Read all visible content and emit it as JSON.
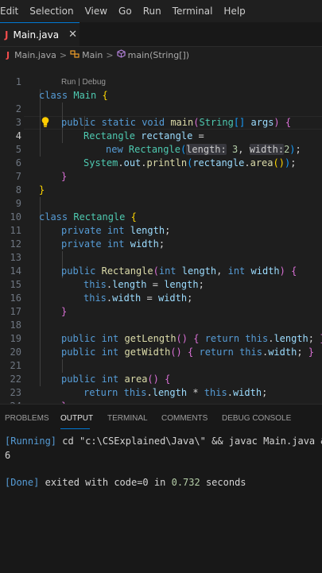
{
  "menu": [
    "Edit",
    "Selection",
    "View",
    "Go",
    "Run",
    "Terminal",
    "Help"
  ],
  "tab": {
    "icon": "J",
    "label": "Main.java",
    "close": "✕"
  },
  "breadcrumb": {
    "file": "Main.java",
    "class_name": "Main",
    "method": "main(String[])",
    "sep": ">"
  },
  "codelens": "Run | Debug",
  "line_numbers": [
    "1",
    "2",
    "3",
    "4",
    "5",
    "6",
    "7",
    "8",
    "9",
    "10",
    "11",
    "12",
    "13",
    "14",
    "15",
    "16",
    "17",
    "18",
    "19",
    "20",
    "21",
    "22",
    "23",
    "24"
  ],
  "code": {
    "l1": {
      "kw": "class",
      "name": "Main",
      "brace": "{"
    },
    "l2": {
      "kw1": "public",
      "kw2": "static",
      "kw3": "void",
      "fn": "main",
      "p_open": "(",
      "type": "String",
      "arr": "[]",
      "param": "args",
      "p_close": ")",
      "brace": "{"
    },
    "l3": {
      "type": "Rectangle",
      "var": "rectangle",
      "eq": "="
    },
    "l4": {
      "kw": "new",
      "type": "Rectangle",
      "p_open": "(",
      "hint1": "length:",
      "v1": "3",
      "comma": ",",
      "hint2": "width:",
      "v2": "2",
      "p_close": ")",
      "semi": ";"
    },
    "l5": {
      "cls": "System",
      "dot1": ".",
      "field": "out",
      "dot2": ".",
      "fn": "println",
      "p_open": "(",
      "var": "rectangle",
      "dot3": ".",
      "fn2": "area",
      "inner": "()",
      "p_close": ")",
      "semi": ";"
    },
    "l6": {
      "brace": "}"
    },
    "l8": {
      "brace": "}"
    },
    "l9": {
      "kw": "class",
      "name": "Rectangle",
      "brace": "{"
    },
    "l10": {
      "kw1": "private",
      "kw2": "int",
      "var": "length",
      "semi": ";"
    },
    "l11": {
      "kw1": "private",
      "kw2": "int",
      "var": "width",
      "semi": ";"
    },
    "l13": {
      "kw1": "public",
      "fn": "Rectangle",
      "p_open": "(",
      "t1": "int",
      "a1": "length",
      "comma": ",",
      "t2": "int",
      "a2": "width",
      "p_close": ")",
      "brace": "{"
    },
    "l14": {
      "kw": "this",
      "dot": ".",
      "field": "length",
      "eq": "=",
      "var": "length",
      "semi": ";"
    },
    "l15": {
      "kw": "this",
      "dot": ".",
      "field": "width",
      "eq": "=",
      "var": "width",
      "semi": ";"
    },
    "l16": {
      "brace": "}"
    },
    "l18": {
      "kw1": "public",
      "kw2": "int",
      "fn": "getLength",
      "parens": "()",
      "b_open": "{",
      "ret": "return",
      "this": "this",
      "dot": ".",
      "field": "length",
      "semi": ";",
      "b_close": "}"
    },
    "l19": {
      "kw1": "public",
      "kw2": "int",
      "fn": "getWidth",
      "parens": "()",
      "b_open": "{",
      "ret": "return",
      "this": "this",
      "dot": ".",
      "field": "width",
      "semi": ";",
      "b_close": "}"
    },
    "l21": {
      "kw1": "public",
      "kw2": "int",
      "fn": "area",
      "parens": "()",
      "brace": "{"
    },
    "l22": {
      "ret": "return",
      "this1": "this",
      "dot1": ".",
      "f1": "length",
      "op": "*",
      "this2": "this",
      "dot2": ".",
      "f2": "width",
      "semi": ";"
    },
    "l23": {
      "brace": "}"
    },
    "l24": {
      "brace": "}"
    }
  },
  "panel": {
    "tabs": [
      "PROBLEMS",
      "OUTPUT",
      "TERMINAL",
      "COMMENTS",
      "DEBUG CONSOLE"
    ],
    "active_tab": "OUTPUT",
    "output": {
      "running_tag": "[Running]",
      "running_cmd": "cd \"c:\\CSExplained\\Java\\\" && javac Main.java &&",
      "result": "6",
      "done_tag": "[Done]",
      "done_text": "exited with",
      "code_label": "code=0",
      "in_text": "in",
      "time": "0.732",
      "seconds": "seconds"
    }
  },
  "colors": {
    "background": "#1e1e1e",
    "panel": "#181818",
    "accent": "#0078d4",
    "java_icon": "#f14c4c",
    "lightbulb": "#ffcc00"
  }
}
